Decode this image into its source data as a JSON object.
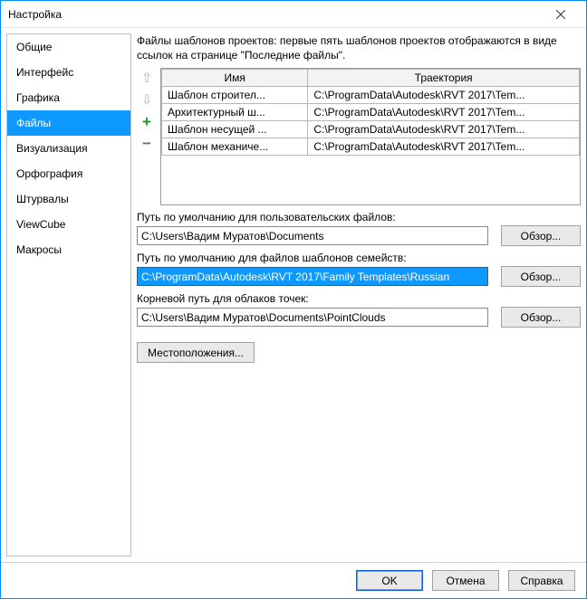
{
  "window": {
    "title": "Настройка"
  },
  "sidebar": {
    "items": [
      {
        "label": "Общие"
      },
      {
        "label": "Интерфейс"
      },
      {
        "label": "Графика"
      },
      {
        "label": "Файлы"
      },
      {
        "label": "Визуализация"
      },
      {
        "label": "Орфография"
      },
      {
        "label": "Штурвалы"
      },
      {
        "label": "ViewCube"
      },
      {
        "label": "Макросы"
      }
    ],
    "selected_index": 3
  },
  "content": {
    "description": "Файлы шаблонов проектов: первые пять шаблонов проектов отображаются в виде ссылок на странице \"Последние файлы\".",
    "reorder": {
      "up": "⇧",
      "down": "⇩",
      "plus": "+",
      "minus": "−"
    },
    "table": {
      "headers": [
        "Имя",
        "Траектория"
      ],
      "rows": [
        {
          "name": "Шаблон строител...",
          "path": "C:\\ProgramData\\Autodesk\\RVT 2017\\Tem..."
        },
        {
          "name": "Архитектурный ш...",
          "path": "C:\\ProgramData\\Autodesk\\RVT 2017\\Tem..."
        },
        {
          "name": "Шаблон несущей ...",
          "path": "C:\\ProgramData\\Autodesk\\RVT 2017\\Tem..."
        },
        {
          "name": "Шаблон механиче...",
          "path": "C:\\ProgramData\\Autodesk\\RVT 2017\\Tem..."
        }
      ]
    },
    "paths": {
      "user_files": {
        "label": "Путь по умолчанию для пользовательских файлов:",
        "value": "C:\\Users\\Вадим Муратов\\Documents",
        "browse": "Обзор..."
      },
      "family_templates": {
        "label": "Путь по умолчанию для файлов шаблонов семейств:",
        "value": "C:\\ProgramData\\Autodesk\\RVT 2017\\Family Templates\\Russian",
        "browse": "Обзор..."
      },
      "point_clouds": {
        "label": "Корневой путь для облаков точек:",
        "value": "C:\\Users\\Вадим Муратов\\Documents\\PointClouds",
        "browse": "Обзор..."
      }
    },
    "locations_btn": "Местоположения..."
  },
  "footer": {
    "ok": "OK",
    "cancel": "Отмена",
    "help": "Справка"
  }
}
